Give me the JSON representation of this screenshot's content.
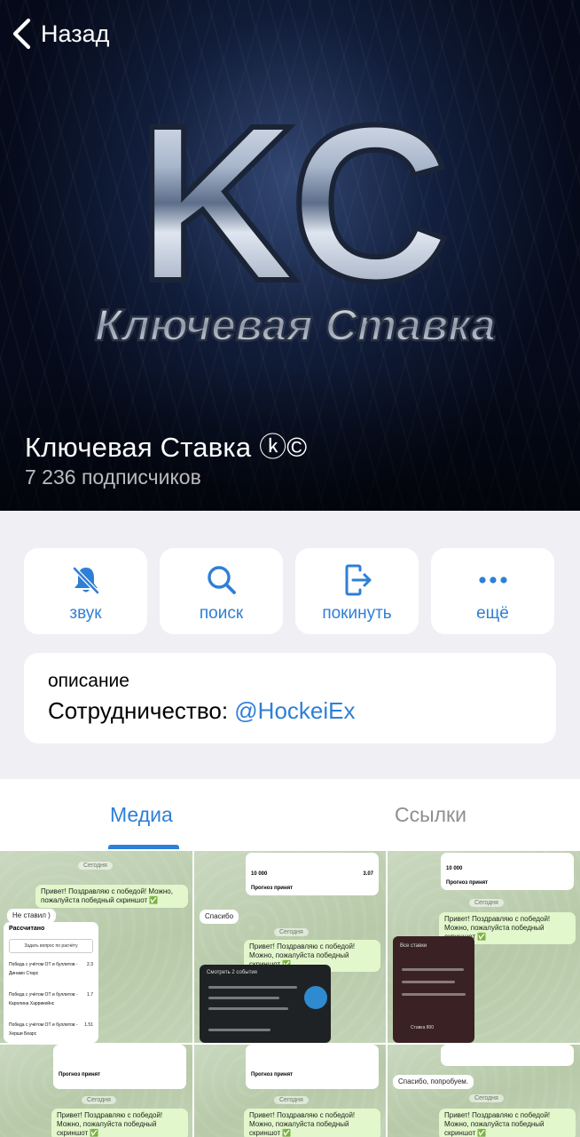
{
  "header": {
    "back_label": "Назад",
    "channel_name": "Ключевая Ставка ⓚ©",
    "subscribers": "7 236 подписчиков",
    "logo_letters": "KC",
    "logo_caption": "Ключевая Ставка"
  },
  "actions": [
    {
      "label": "звук",
      "icon": "bell-slash-icon"
    },
    {
      "label": "поиск",
      "icon": "search-icon"
    },
    {
      "label": "покинуть",
      "icon": "leave-icon"
    },
    {
      "label": "ещё",
      "icon": "more-icon"
    }
  ],
  "description": {
    "heading": "описание",
    "text": "Сотрудничество: ",
    "link": "@HockeiEx"
  },
  "tabs": [
    {
      "label": "Медиа",
      "active": true
    },
    {
      "label": "Ссылки",
      "active": false
    }
  ],
  "media": {
    "thumb1": {
      "msg_out": "Привет! Поздравляю с победой! Можно, пожалуйста победный скриншот ✅",
      "msg_in": "Не ставил )",
      "date": "Сегодня",
      "card_title": "Рассчитано",
      "card_button": "Задать вопрос по расчёту",
      "card_rows": [
        "Победа с учётом ОТ и буллитов - Динамо Старс",
        "Победа с учётом ОТ и буллитов - Каролина Харрикейнс",
        "Победа с учётом ОТ и буллитов - Херши Беарс"
      ],
      "card_odds": [
        "2.3",
        "1.7",
        "1.51"
      ]
    },
    "thumb2": {
      "msg_in": "Спасибо",
      "msg_out": "Привет! Поздравляю с победой! Можно, пожалуйста победный скриншот ✅",
      "date": "Сегодня",
      "amount": "10 000",
      "odds": "3.07",
      "status": "Прогноз принят",
      "screen_title": "Смотреть 2 события"
    },
    "thumb3": {
      "msg_out": "Привет! Поздравляю с победой! Можно, пожалуйста победный скриншот ✅",
      "date": "Сегодня",
      "amount": "10 000",
      "status": "Прогноз принят",
      "screen_title": "Все ставки",
      "screen_amount": "Ставка 800"
    },
    "thumb4": {
      "msg_out": "Привет! Поздравляю с победой! Можно, пожалуйста победный скриншот ✅",
      "date": "Сегодня",
      "status": "Прогноз принят"
    },
    "thumb5": {
      "msg_out": "Привет! Поздравляю с победой! Можно, пожалуйста победный скриншот ✅",
      "date": "Сегодня",
      "status": "Прогноз принят"
    },
    "thumb6": {
      "msg_in": "Спасибо, попробуем.",
      "msg_out": "Привет! Поздравляю с победой! Можно, пожалуйста победный скриншот ✅",
      "date": "Сегодня"
    }
  },
  "colors": {
    "accent": "#2f7fd6",
    "background": "#efeff4",
    "card": "#ffffff"
  }
}
